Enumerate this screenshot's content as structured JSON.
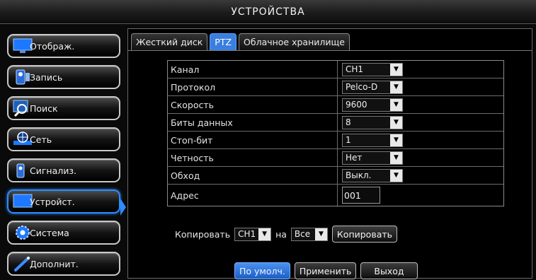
{
  "window": {
    "title": "УСТРОЙСТВА"
  },
  "sidebar": {
    "items": [
      {
        "label": "Отображ.",
        "icon": "monitor-icon"
      },
      {
        "label": "Запись",
        "icon": "record-icon"
      },
      {
        "label": "Поиск",
        "icon": "search-icon"
      },
      {
        "label": "Сеть",
        "icon": "network-icon"
      },
      {
        "label": "Сигнализ.",
        "icon": "alarm-icon"
      },
      {
        "label": "Устройст.",
        "icon": "device-icon",
        "active": true
      },
      {
        "label": "Система",
        "icon": "gear-icon"
      },
      {
        "label": "Дополнит.",
        "icon": "tool-icon"
      }
    ]
  },
  "tabs": [
    {
      "label": "Жесткий диск"
    },
    {
      "label": "PTZ",
      "active": true
    },
    {
      "label": "Облачное хранилище"
    }
  ],
  "form": {
    "channel": {
      "label": "Канал",
      "value": "CH1"
    },
    "protocol": {
      "label": "Протокол",
      "value": "Pelco-D"
    },
    "speed": {
      "label": "Скорость",
      "value": "9600"
    },
    "databits": {
      "label": "Биты данных",
      "value": "8"
    },
    "stopbit": {
      "label": "Стоп-бит",
      "value": "1"
    },
    "parity": {
      "label": "Четность",
      "value": "Нет"
    },
    "tour": {
      "label": "Обход",
      "value": "Выкл."
    },
    "address": {
      "label": "Адрес",
      "value": "001"
    }
  },
  "copy": {
    "label": "Копировать",
    "from": "CH1",
    "to_label": "на",
    "to": "Все",
    "button": "Копировать"
  },
  "buttons": {
    "default": "По умолч.",
    "apply": "Применить",
    "exit": "Выход"
  },
  "colors": {
    "accent": "#2d8cff",
    "active_tab": "#3a7fe0"
  }
}
